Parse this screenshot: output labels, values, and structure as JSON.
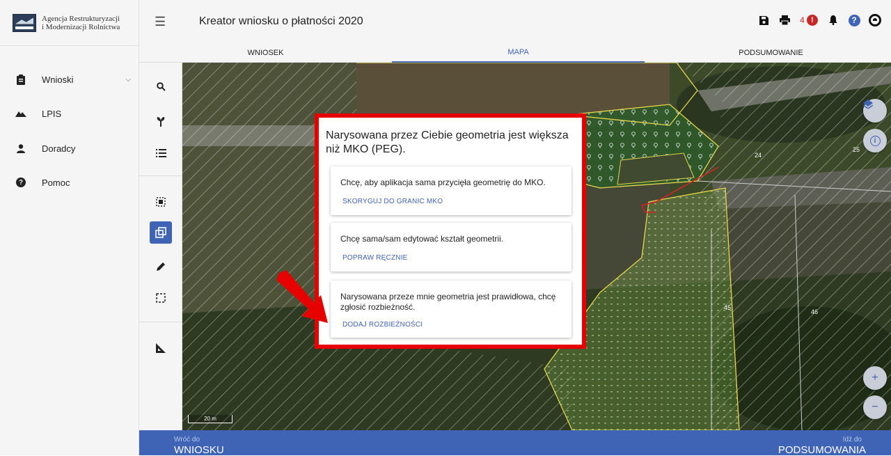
{
  "brand": {
    "line1": "Agencja Restrukturyzacji",
    "line2": "i Modernizacji Rolnictwa"
  },
  "sidebar": {
    "items": [
      {
        "label": "Wnioski",
        "icon": "clipboard-icon"
      },
      {
        "label": "LPIS",
        "icon": "mountain-icon"
      },
      {
        "label": "Doradcy",
        "icon": "person-icon"
      },
      {
        "label": "Pomoc",
        "icon": "help-icon"
      }
    ]
  },
  "header": {
    "title": "Kreator wniosku o płatności 2020",
    "alerts_count": "4"
  },
  "tabs": [
    {
      "label": "WNIOSEK",
      "active": false
    },
    {
      "label": "MAPA",
      "active": true
    },
    {
      "label": "PODSUMOWANIE",
      "active": false
    }
  ],
  "map": {
    "scale": "20 m",
    "parcel_labels": [
      "24",
      "25",
      "45",
      "46"
    ]
  },
  "dialog": {
    "title": "Narysowana przez Ciebie geometria jest większa niż MKO (PEG).",
    "options": [
      {
        "text": "Chcę, aby aplikacja sama przycięła geometrię do MKO.",
        "action": "SKORYGUJ DO GRANIC MKO"
      },
      {
        "text": "Chcę sama/sam edytować kształt geometrii.",
        "action": "POPRAW RĘCZNIE"
      },
      {
        "text": "Narysowana przeze mnie geometria jest prawidłowa, chcę zgłosić rozbieżność.",
        "action": "DODAJ ROZBIEŻNOŚCI"
      }
    ]
  },
  "footer": {
    "back_small": "Wróć do",
    "back_big": "WNIOSKU",
    "next_small": "Idź do",
    "next_big": "PODSUMOWANIA"
  },
  "colors": {
    "accent": "#3f63b5",
    "highlight_frame": "#e60000",
    "alert": "#c62828"
  }
}
